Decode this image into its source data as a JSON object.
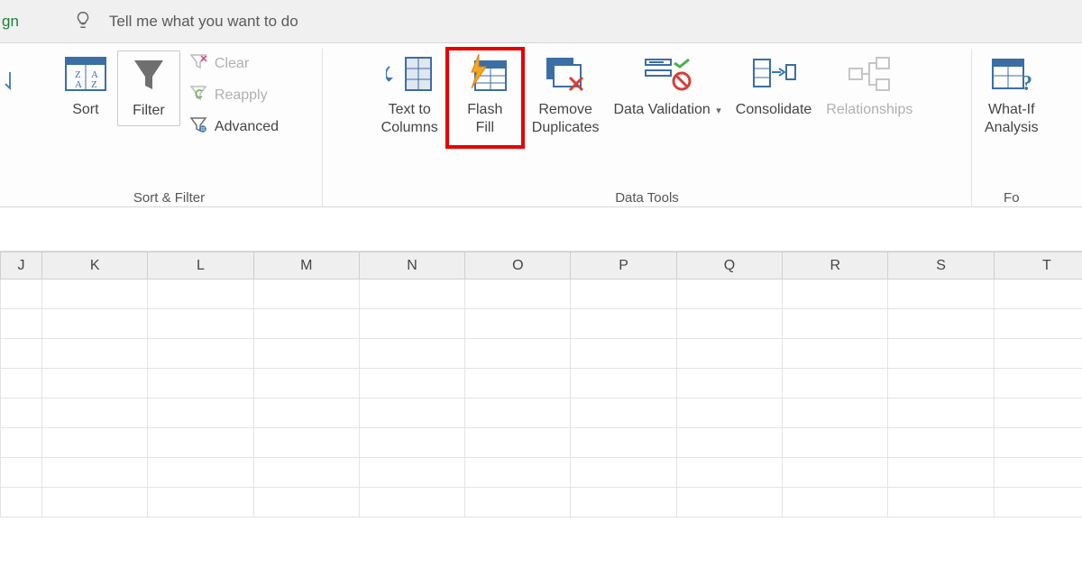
{
  "topbar": {
    "tab_fragment": "gn",
    "tellme": "Tell me what you want to do"
  },
  "ribbon": {
    "group_sort_filter": {
      "sort": "Sort",
      "filter": "Filter",
      "clear": "Clear",
      "reapply": "Reapply",
      "advanced": "Advanced",
      "label": "Sort & Filter"
    },
    "group_data_tools": {
      "text_to_columns": "Text to Columns",
      "flash_fill": "Flash Fill",
      "remove_duplicates": "Remove Duplicates",
      "data_validation": "Data Validation",
      "consolidate": "Consolidate",
      "relationships": "Relationships",
      "label": "Data Tools"
    },
    "group_forecast": {
      "what_if": "What-If Analysis",
      "label": "Fo"
    }
  },
  "columns": [
    "J",
    "K",
    "L",
    "M",
    "N",
    "O",
    "P",
    "Q",
    "R",
    "S",
    "T"
  ],
  "icons": {
    "bulb": "bulb-icon",
    "sort_az": "sort-az-icon",
    "filter": "filter-funnel-icon",
    "clear": "clear-funnel-icon",
    "reapply": "reapply-funnel-icon",
    "advanced": "advanced-funnel-icon",
    "text_to_columns": "text-to-columns-icon",
    "flash_fill": "flash-fill-icon",
    "remove_duplicates": "remove-duplicates-icon",
    "data_validation": "data-validation-icon",
    "consolidate": "consolidate-icon",
    "relationships": "relationships-icon",
    "what_if": "what-if-icon",
    "refresh_arrow": "refresh-arrow-icon"
  }
}
